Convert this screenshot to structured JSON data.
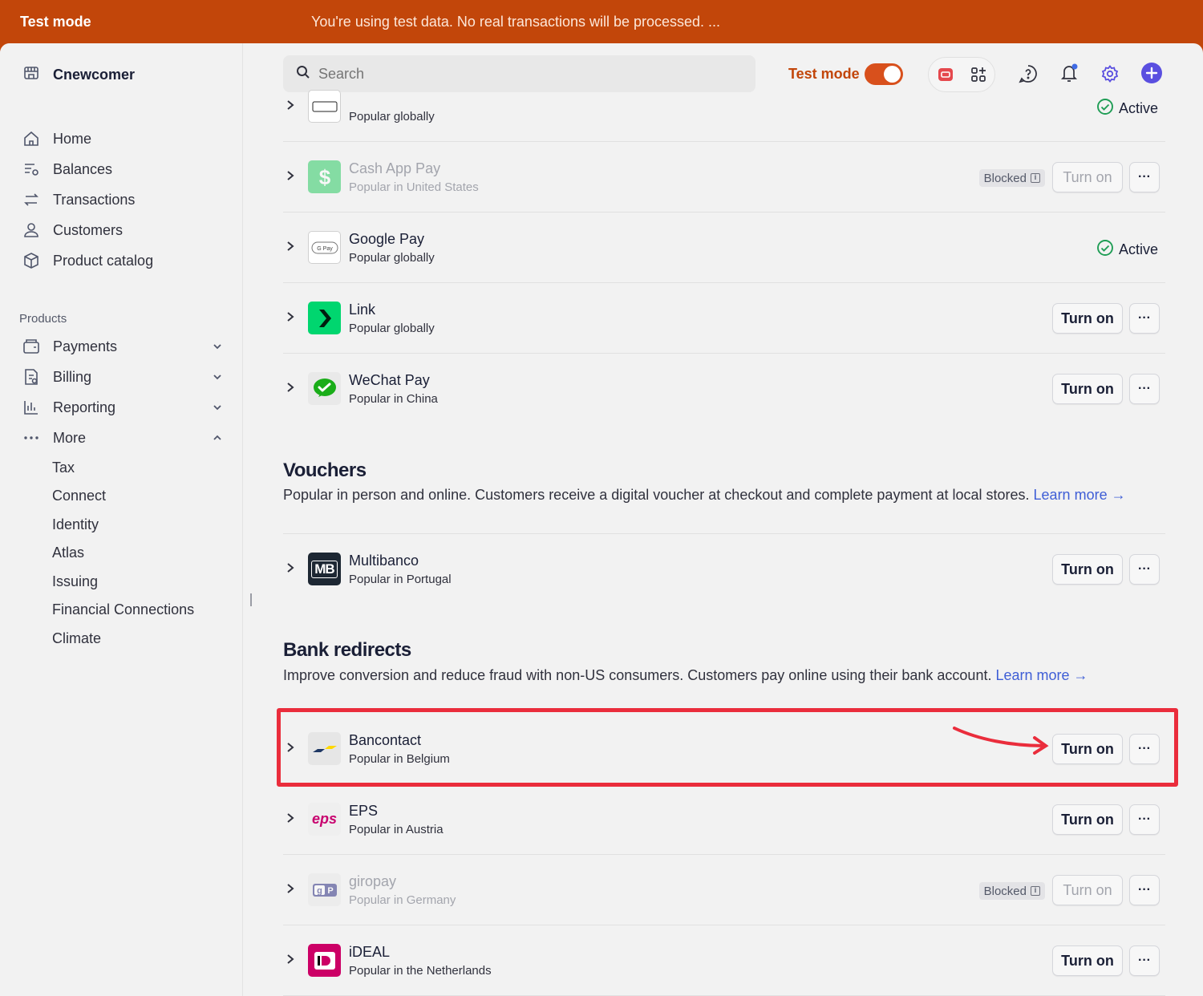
{
  "banner": {
    "title": "Test mode",
    "message": "You're using test data. No real transactions will be processed. ..."
  },
  "account": {
    "name": "Cnewcomer"
  },
  "nav": {
    "primary": [
      {
        "label": "Home",
        "icon": "home-icon"
      },
      {
        "label": "Balances",
        "icon": "balances-icon"
      },
      {
        "label": "Transactions",
        "icon": "transactions-icon"
      },
      {
        "label": "Customers",
        "icon": "customers-icon"
      },
      {
        "label": "Product catalog",
        "icon": "product-catalog-icon"
      }
    ],
    "products_label": "Products",
    "products": [
      {
        "label": "Payments",
        "icon": "payments-icon",
        "expanded": false
      },
      {
        "label": "Billing",
        "icon": "billing-icon",
        "expanded": false
      },
      {
        "label": "Reporting",
        "icon": "reporting-icon",
        "expanded": false
      },
      {
        "label": "More",
        "icon": "more-dots-icon",
        "expanded": true
      }
    ],
    "more_items": [
      "Tax",
      "Connect",
      "Identity",
      "Atlas",
      "Issuing",
      "Financial Connections",
      "Climate"
    ]
  },
  "header": {
    "search_placeholder": "Search",
    "test_mode_label": "Test mode",
    "test_mode_on": true
  },
  "wallets": [
    {
      "name": "",
      "sub": "Popular globally",
      "status": "Active",
      "logo": "apple-pay-logo"
    },
    {
      "name": "Cash App Pay",
      "sub": "Popular in United States",
      "status": "blocked",
      "logo": "cash-app-logo"
    },
    {
      "name": "Google Pay",
      "sub": "Popular globally",
      "status": "Active",
      "logo": "google-pay-logo"
    },
    {
      "name": "Link",
      "sub": "Popular globally",
      "status": "off",
      "logo": "link-logo"
    },
    {
      "name": "WeChat Pay",
      "sub": "Popular in China",
      "status": "off",
      "logo": "wechat-pay-logo"
    }
  ],
  "vouchers": {
    "title": "Vouchers",
    "description": "Popular in person and online. Customers receive a digital voucher at checkout and complete payment at local stores.",
    "learn_more": "Learn more →",
    "items": [
      {
        "name": "Multibanco",
        "sub": "Popular in Portugal",
        "status": "off",
        "logo": "multibanco-logo",
        "logo_text": "MB"
      }
    ]
  },
  "bank_redirects": {
    "title": "Bank redirects",
    "description": "Improve conversion and reduce fraud with non-US consumers. Customers pay online using their bank account.",
    "learn_more": "Learn more →",
    "items": [
      {
        "name": "Bancontact",
        "sub": "Popular in Belgium",
        "status": "off",
        "logo": "bancontact-logo"
      },
      {
        "name": "EPS",
        "sub": "Popular in Austria",
        "status": "off",
        "logo": "eps-logo",
        "logo_text": "eps"
      },
      {
        "name": "giropay",
        "sub": "Popular in Germany",
        "status": "blocked",
        "logo": "giropay-logo"
      },
      {
        "name": "iDEAL",
        "sub": "Popular in the Netherlands",
        "status": "off",
        "logo": "ideal-logo"
      }
    ]
  },
  "labels": {
    "turn_on": "Turn on",
    "blocked": "Blocked",
    "active": "Active",
    "more": "···"
  },
  "colors": {
    "accent_orange": "#c2460a",
    "link_blue": "#3f5ed6",
    "active_green": "#1f9d55",
    "highlight_red": "#ea2d3c"
  }
}
